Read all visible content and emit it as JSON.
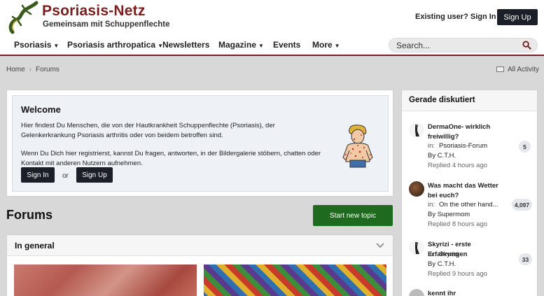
{
  "header": {
    "logo_title": "Psoriasis-Netz",
    "logo_subtitle": "Gemeinsam mit Schuppenflechte",
    "signin_label": "Existing user? Sign In",
    "signup_label": "Sign Up"
  },
  "nav": {
    "items": [
      {
        "label": "Psoriasis",
        "dropdown": true
      },
      {
        "label": "Psoriasis arthropatica",
        "dropdown": true
      },
      {
        "label": "Newsletters",
        "dropdown": false
      },
      {
        "label": "Magazine",
        "dropdown": true
      },
      {
        "label": "Events",
        "dropdown": false
      },
      {
        "label": "More",
        "dropdown": true
      }
    ],
    "search_placeholder": "Search..."
  },
  "breadcrumb": {
    "home": "Home",
    "current": "Forums",
    "all_activity": "All Activity"
  },
  "welcome": {
    "title": "Welcome",
    "text1": "Hier findest Du Menschen, die von der Hautkrankheit Schuppenflechte (Psoriasis), der Gelenkerkrankung Psoriasis arthritis oder von beidem betroffen sind.",
    "text2": "Wenn Du Dich hier registrierst, kannst Du fragen, antworten, in der Bildergalerie stöbern, chatten oder Kontakt mit anderen Nutzern aufnehmen.",
    "signin_label": "Sign In",
    "or_label": "or",
    "signup_label": "Sign Up"
  },
  "forums": {
    "title": "Forums",
    "start_topic_label": "Start new topic",
    "section_title": "In general"
  },
  "sidebar": {
    "title": "Gerade diskutiert",
    "topics": [
      {
        "title": "DermaOne- wirklich freiwillig?",
        "in_label": "in:",
        "forum": "Psoriasis-Forum",
        "by": "By C.T.H.",
        "replied": "Replied 4 hours ago",
        "count": "5"
      },
      {
        "title": "Was macht das Wetter bei euch?",
        "in_label": "in:",
        "forum": "On the other hand...",
        "by": "By Supermom",
        "replied": "Replied 8 hours ago",
        "count": "4,097"
      },
      {
        "title": "Skyrizi - erste Erfahrungen",
        "in_label": "in:",
        "forum": "Skyrizi",
        "by": "By C.T.H.",
        "replied": "Replied 9 hours ago",
        "count": "33"
      },
      {
        "title": "kennt ihr Impfverweigerer -"
      }
    ]
  },
  "colors": {
    "brand": "#7a1e1e",
    "dark_button": "#1b1f27",
    "green_button": "#1e6a1e"
  }
}
